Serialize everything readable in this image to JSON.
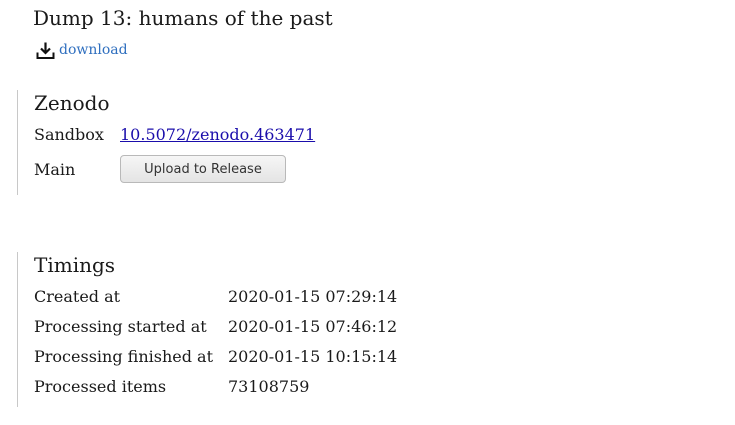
{
  "page": {
    "title": "Dump 13: humans of the past",
    "download_label": "download",
    "download_icon": "download-icon"
  },
  "zenodo": {
    "title": "Zenodo",
    "sandbox_label": "Sandbox",
    "sandbox_link": "10.5072/zenodo.463471",
    "main_label": "Main",
    "upload_button": "Upload to Release"
  },
  "timings": {
    "title": "Timings",
    "rows": [
      {
        "label": "Created at",
        "value": "2020-01-15 07:29:14"
      },
      {
        "label": "Processing started at",
        "value": "2020-01-15 07:46:12"
      },
      {
        "label": "Processing finished at",
        "value": "2020-01-15 10:15:14"
      },
      {
        "label": "Processed items",
        "value": "73108759"
      }
    ]
  },
  "colors": {
    "link": "#1a0dab",
    "download_link": "#2f6fbf",
    "divider": "#c8c8c8"
  }
}
